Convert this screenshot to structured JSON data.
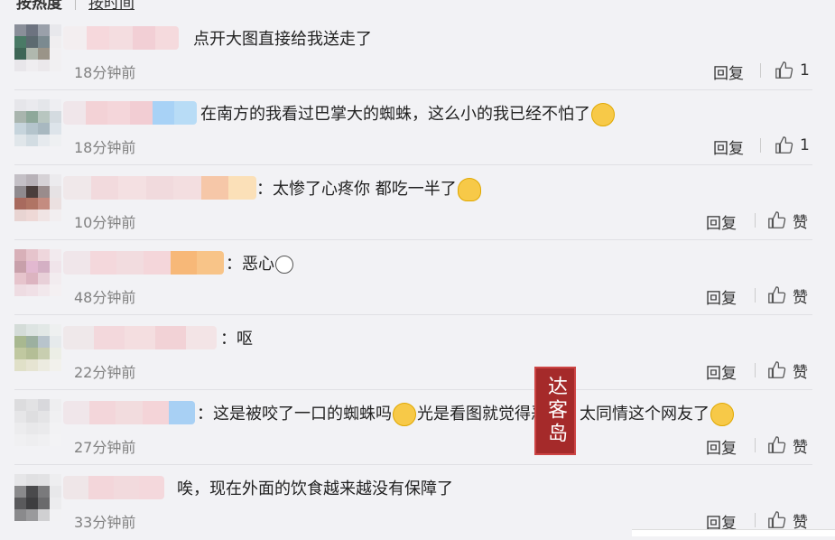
{
  "sort": {
    "hot": "按热度",
    "time": "按时间"
  },
  "actions": {
    "reply": "回复",
    "like": "赞"
  },
  "watermark": "达客岛",
  "comments": [
    {
      "text": "点开大图直接给我送走了",
      "time": "18分钟前",
      "likes": "1"
    },
    {
      "text": "在南方的我看过巴掌大的蜘蛛，这么小的我已经不怕了",
      "emoji": "laughing-tears-icon",
      "time": "18分钟前",
      "likes": "1"
    },
    {
      "text": "：太惨了心疼你 都吃一半了",
      "emoji": "hug-icon",
      "time": "10分钟前",
      "likes": "赞"
    },
    {
      "text": "：恶心",
      "emoji": "sad-face-icon",
      "time": "48分钟前",
      "likes": "赞"
    },
    {
      "text": "：呕",
      "time": "22分钟前",
      "likes": "赞"
    },
    {
      "text_a": "：这是被咬了一口的蜘蛛吗",
      "text_b": "光是看图就觉得恶心，太同情这个网友了",
      "emoji_a": "awkward-face-icon",
      "emoji_b": "laughing-tears-icon",
      "time": "27分钟前",
      "likes": "赞"
    },
    {
      "text": "唉，现在外面的饮食越来越没有保障了",
      "time": "33分钟前",
      "likes": "赞"
    }
  ]
}
